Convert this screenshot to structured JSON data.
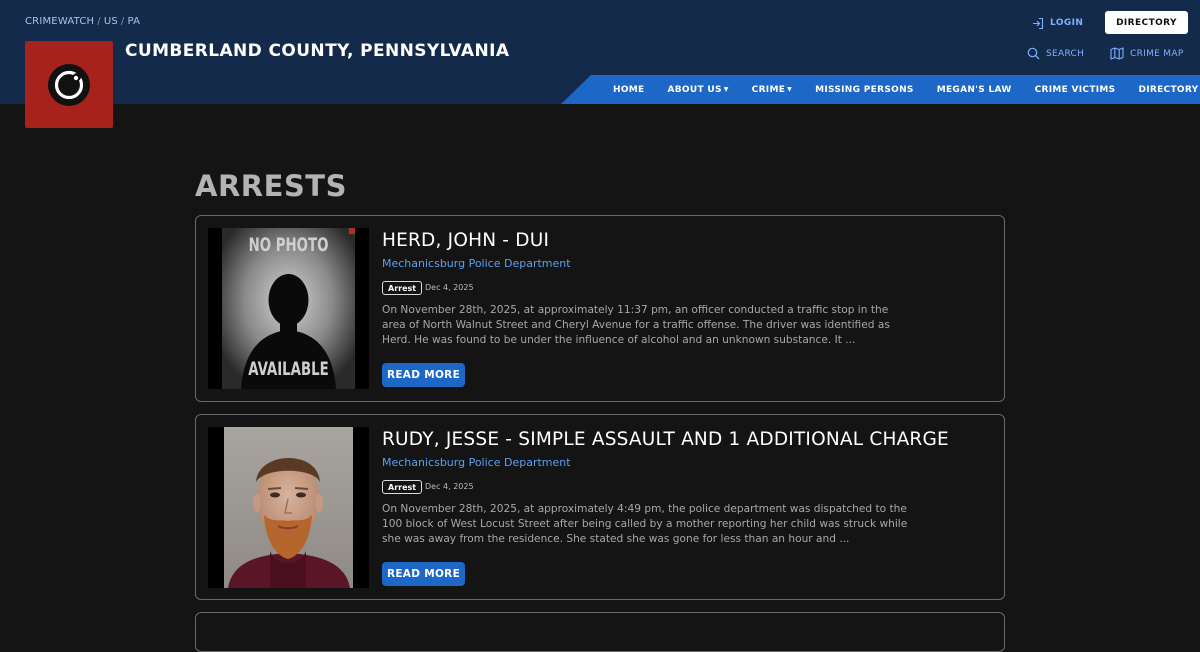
{
  "header": {
    "breadcrumb": [
      "CRIMEWATCH",
      "US",
      "PA"
    ],
    "site_title": "CUMBERLAND COUNTY, PENNSYLVANIA",
    "login_label": "LOGIN",
    "directory_button": "DIRECTORY",
    "search_label": "SEARCH",
    "crime_map_label": "CRIME MAP"
  },
  "nav": {
    "items": [
      {
        "label": "HOME",
        "dropdown": false
      },
      {
        "label": "ABOUT US",
        "dropdown": true
      },
      {
        "label": "CRIME",
        "dropdown": true
      },
      {
        "label": "MISSING PERSONS",
        "dropdown": false
      },
      {
        "label": "MEGAN'S LAW",
        "dropdown": false
      },
      {
        "label": "CRIME VICTIMS",
        "dropdown": false
      },
      {
        "label": "DIRECTORY",
        "dropdown": false
      }
    ]
  },
  "main": {
    "page_title": "ARRESTS",
    "arrests": [
      {
        "title": "HERD, JOHN - DUI",
        "department": "Mechanicsburg Police Department",
        "badge": "Arrest",
        "date": "Dec 4, 2025",
        "excerpt": "On November 28th, 2025, at approximately 11:37 pm, an officer conducted a traffic stop in the area of North Walnut Street and Cheryl Avenue for a traffic offense. The driver was identified as Herd. He was found to be under the influence of alcohol and an unknown substance. It ...",
        "read_more": "READ MORE",
        "photo_top_text": "NO PHOTO",
        "photo_bottom_text": "AVAILABLE"
      },
      {
        "title": "RUDY, JESSE - SIMPLE ASSAULT AND 1 ADDITIONAL CHARGE",
        "department": "Mechanicsburg Police Department",
        "badge": "Arrest",
        "date": "Dec 4, 2025",
        "excerpt": "On November 28th, 2025, at approximately 4:49 pm, the police department was dispatched to the 100 block of West Locust Street after being called by a mother reporting her child was struck while she was away from the residence. She stated she was gone for less than an hour and ...",
        "read_more": "READ MORE"
      }
    ]
  },
  "colors": {
    "header_bg": "#142a4a",
    "nav_bg": "#1d68c7",
    "logo_bg": "#a8221c",
    "link": "#5aa0f0",
    "page_bg": "#141414"
  }
}
